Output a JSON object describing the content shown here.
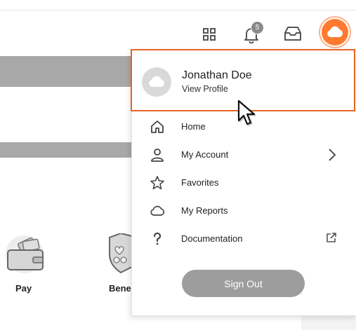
{
  "header": {
    "notification_count": "5",
    "icons": [
      "apps-grid-icon",
      "bell-icon",
      "inbox-icon",
      "cloud-avatar-icon"
    ]
  },
  "tiles": [
    {
      "label": "Pay",
      "icon": "wallet-icon"
    },
    {
      "label": "Bene",
      "icon": "shield-icon"
    }
  ],
  "profile": {
    "name": "Jonathan Doe",
    "link": "View Profile",
    "avatar_icon": "cloud-icon"
  },
  "menu": {
    "items": [
      {
        "label": "Home",
        "icon": "home-icon"
      },
      {
        "label": "My Account",
        "icon": "person-icon",
        "right_icon": "chevron-right-icon"
      },
      {
        "label": "Favorites",
        "icon": "star-icon"
      },
      {
        "label": "My Reports",
        "icon": "cloud-outline-icon"
      },
      {
        "label": "Documentation",
        "icon": "question-icon",
        "right_icon": "external-link-icon"
      }
    ],
    "sign_out_label": "Sign Out"
  },
  "colors": {
    "accent": "#e8631f",
    "avatar_bg": "#ff7a2f",
    "button_gray": "#9d9d9d"
  }
}
